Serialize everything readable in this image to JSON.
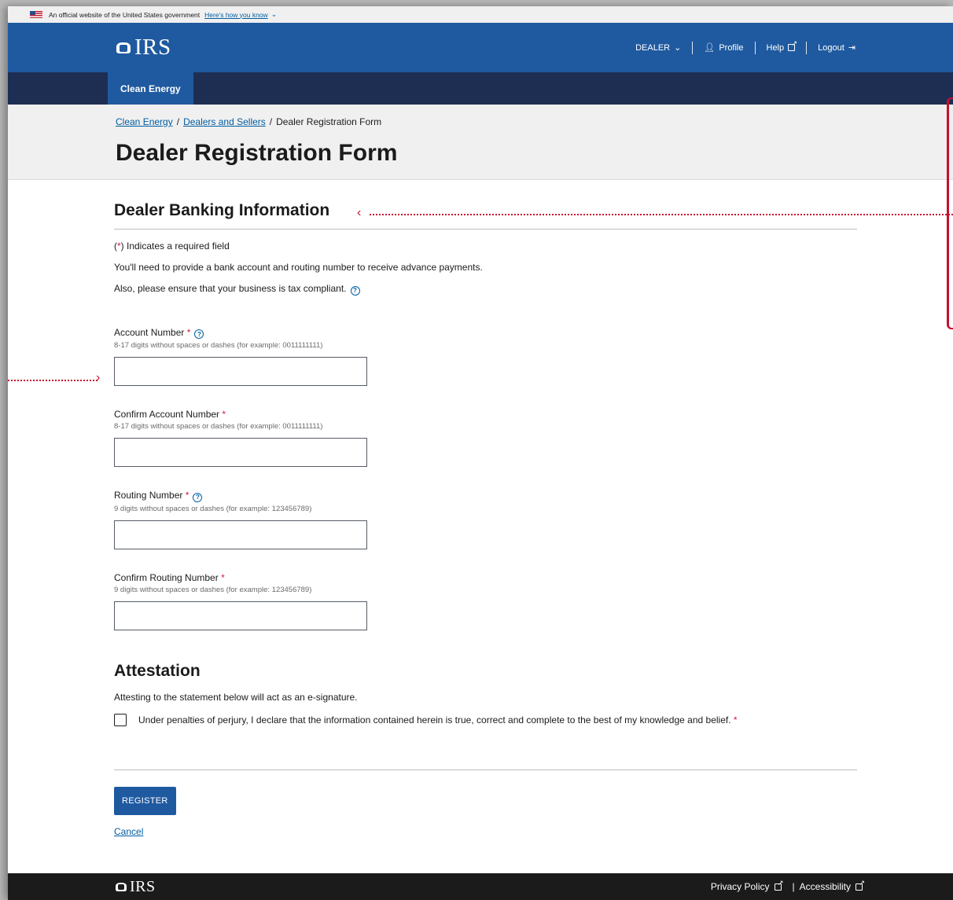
{
  "gov_banner": {
    "text": "An official website of the United States government",
    "link": "Here's how you know"
  },
  "header": {
    "logo": "IRS",
    "nav": {
      "dealer": "DEALER",
      "profile": "Profile",
      "help": "Help",
      "logout": "Logout"
    }
  },
  "subnav": {
    "tab": "Clean Energy"
  },
  "breadcrumb": {
    "item1": "Clean Energy",
    "item2": "Dealers and Sellers",
    "current": "Dealer Registration Form",
    "sep": "/"
  },
  "page_title": "Dealer Registration Form",
  "section": {
    "title": "Dealer Banking Information",
    "required_note_prefix": "(",
    "required_note_star": "*",
    "required_note_suffix": ") Indicates a required field",
    "para1": "You'll need to provide a bank account and routing number to receive advance payments.",
    "para2": "Also, please ensure that your business is tax compliant."
  },
  "fields": [
    {
      "label": "Account Number",
      "hint": "8-17 digits without spaces or dashes (for example: 0011111111)",
      "value": ""
    },
    {
      "label": "Confirm Account Number",
      "hint": "8-17 digits without spaces or dashes (for example: 0011111111)",
      "value": ""
    },
    {
      "label": "Routing Number",
      "hint": "9 digits without spaces or dashes (for example: 123456789)",
      "value": ""
    },
    {
      "label": "Confirm Routing Number",
      "hint": "9 digits without spaces or dashes (for example: 123456789)",
      "value": ""
    }
  ],
  "attestation": {
    "title": "Attestation",
    "intro": "Attesting to the statement below will act as an e-signature.",
    "checkbox_label": "Under penalties of perjury, I declare that the information contained herein is true, correct and complete to the best of my knowledge and belief.",
    "checked": false
  },
  "actions": {
    "register": "REGISTER",
    "cancel": "Cancel"
  },
  "footer": {
    "logo": "IRS",
    "privacy": "Privacy Policy",
    "divider": "|",
    "accessibility": "Accessibility"
  },
  "colors": {
    "header_blue": "#1f5aa0",
    "subnav_navy": "#1d2e52",
    "link_blue": "#005ea2",
    "required_red": "#d6193c",
    "annotation_red": "#c8102e"
  }
}
